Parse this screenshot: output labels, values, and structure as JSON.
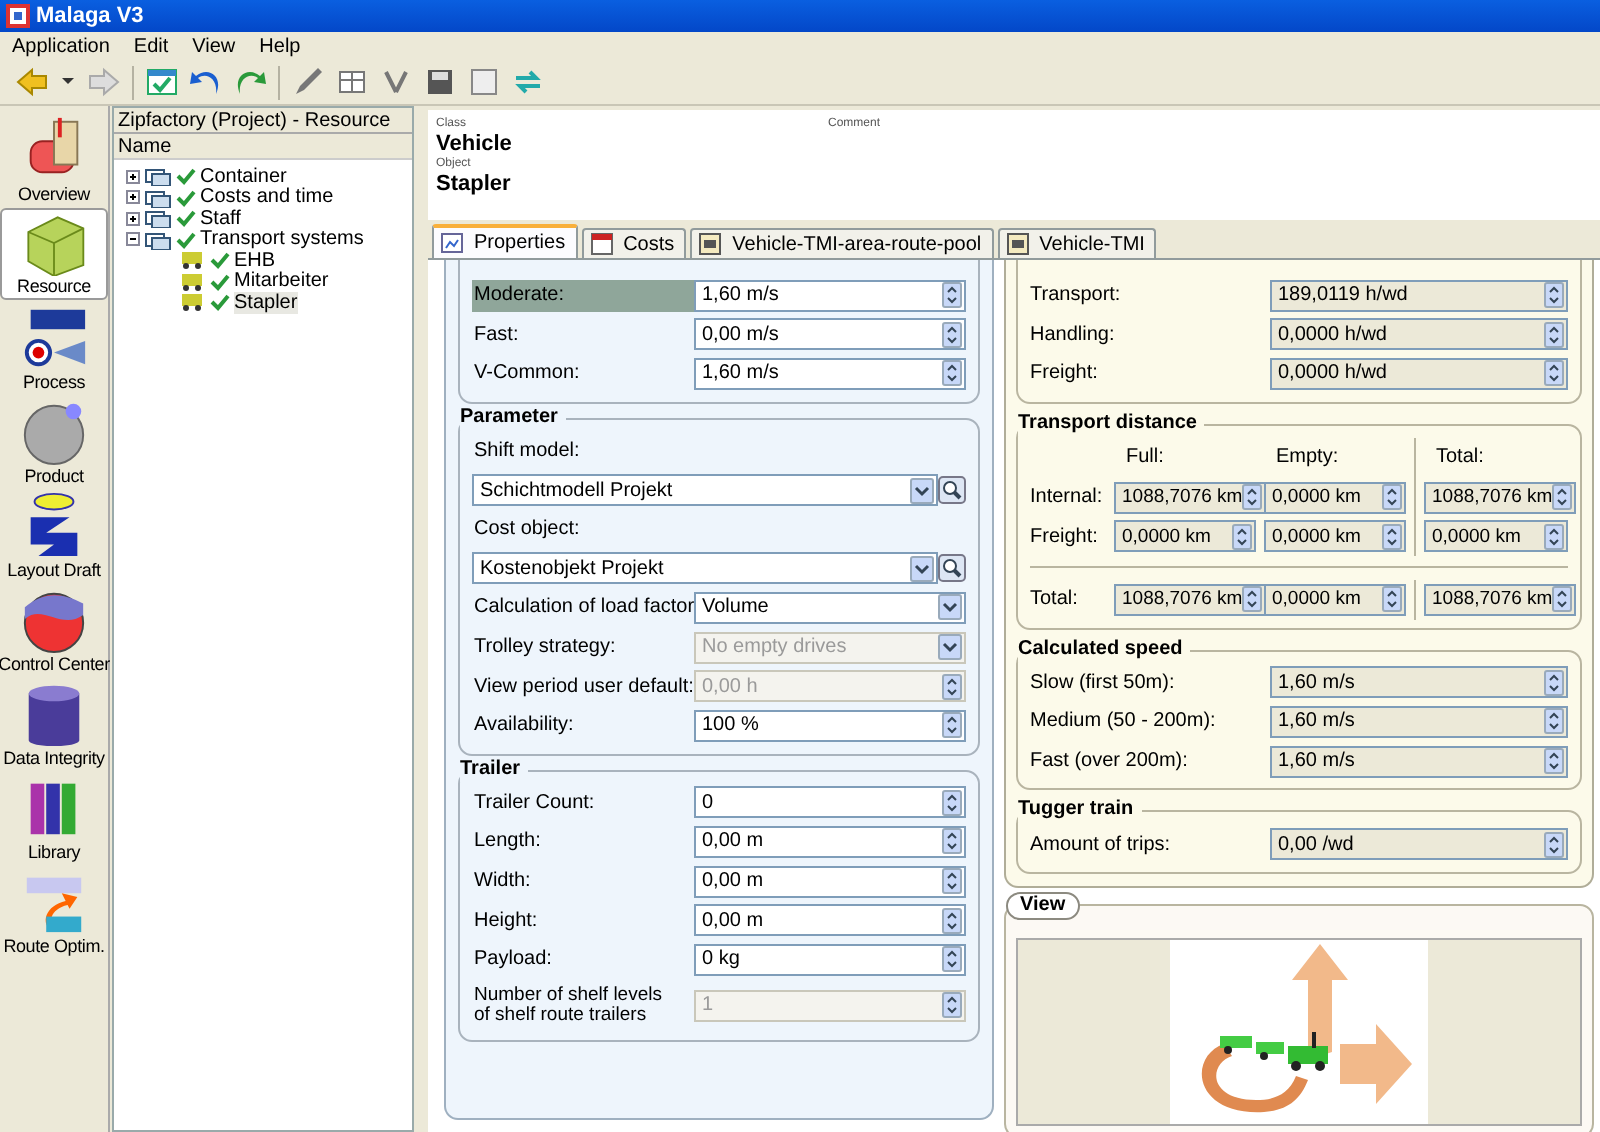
{
  "window": {
    "title": "Malaga V3"
  },
  "menu": [
    "Application",
    "Edit",
    "View",
    "Help"
  ],
  "nav": [
    {
      "label": "Overview",
      "selected": false
    },
    {
      "label": "Resource",
      "selected": true
    },
    {
      "label": "Process",
      "selected": false
    },
    {
      "label": "Product",
      "selected": false
    },
    {
      "label": "Layout Draft",
      "selected": false
    },
    {
      "label": "Control Center",
      "selected": false
    },
    {
      "label": "Data Integrity",
      "selected": false
    },
    {
      "label": "Library",
      "selected": false
    },
    {
      "label": "Route Optim.",
      "selected": false
    }
  ],
  "tree": {
    "title": "Zipfactory (Project) - Resource",
    "column": "Name",
    "items": [
      {
        "label": "Container",
        "expanded": false,
        "selected": false
      },
      {
        "label": "Costs and time",
        "expanded": false,
        "selected": false
      },
      {
        "label": "Staff",
        "expanded": false,
        "selected": false
      },
      {
        "label": "Transport systems",
        "expanded": true,
        "selected": false,
        "children": [
          {
            "label": "EHB",
            "selected": false
          },
          {
            "label": "Mitarbeiter",
            "selected": false
          },
          {
            "label": "Stapler",
            "selected": true
          }
        ]
      }
    ]
  },
  "header": {
    "class_label": "Class",
    "class_value": "Vehicle",
    "object_label": "Object",
    "object_value": "Stapler",
    "comment_label": "Comment"
  },
  "tabs": [
    {
      "label": "Properties",
      "selected": true
    },
    {
      "label": "Costs",
      "selected": false
    },
    {
      "label": "Vehicle-TMI-area-route-pool",
      "selected": false
    },
    {
      "label": "Vehicle-TMI",
      "selected": false
    }
  ],
  "left_groups": [
    {
      "rows": [
        {
          "kind": "spin",
          "label": "Moderate:",
          "value": "1,60 m/s",
          "highlighted": true,
          "disabled": false
        },
        {
          "kind": "spin",
          "label": "Fast:",
          "value": "0,00 m/s",
          "highlighted": false,
          "disabled": false
        },
        {
          "kind": "spin",
          "label": "V-Common:",
          "value": "1,60 m/s",
          "highlighted": false,
          "disabled": false
        }
      ]
    },
    {
      "title": "Parameter",
      "rows": [
        {
          "kind": "lookup",
          "label": "Shift model:",
          "value": "Schichtmodell Projekt",
          "highlighted": false,
          "disabled": false
        },
        {
          "kind": "lookup",
          "label": "Cost object:",
          "value": "Kostenobjekt Projekt",
          "highlighted": false,
          "disabled": false
        },
        {
          "kind": "combo",
          "label": "Calculation of load factor:",
          "value": "Volume",
          "highlighted": false,
          "disabled": false
        },
        {
          "kind": "combo",
          "label": "Trolley strategy:",
          "value": "No empty drives",
          "highlighted": false,
          "disabled": true
        },
        {
          "kind": "spin",
          "label": "View period user default:",
          "value": "0,00 h",
          "highlighted": false,
          "disabled": true
        },
        {
          "kind": "spin",
          "label": "Availability:",
          "value": "100 %",
          "highlighted": false,
          "disabled": false
        }
      ]
    },
    {
      "title": "Trailer",
      "rows": [
        {
          "kind": "spin",
          "label": "Trailer Count:",
          "value": "0",
          "highlighted": false,
          "disabled": false
        },
        {
          "kind": "spin",
          "label": "Length:",
          "value": "0,00 m",
          "highlighted": false,
          "disabled": false
        },
        {
          "kind": "spin",
          "label": "Width:",
          "value": "0,00 m",
          "highlighted": false,
          "disabled": false
        },
        {
          "kind": "spin",
          "label": "Height:",
          "value": "0,00 m",
          "highlighted": false,
          "disabled": false
        },
        {
          "kind": "spin",
          "label": "Payload:",
          "value": "0 kg",
          "highlighted": false,
          "disabled": false
        },
        {
          "kind": "spin",
          "label": "Number of shelf levels\nof shelf route trailers",
          "value": "1",
          "highlighted": false,
          "disabled": true
        }
      ]
    }
  ],
  "right_groups": [
    {
      "kind": "rows",
      "rows": [
        {
          "label": "Transport:",
          "value": "189,0119 h/wd"
        },
        {
          "label": "Handling:",
          "value": "0,0000 h/wd"
        },
        {
          "label": "Freight:",
          "value": "0,0000 h/wd"
        }
      ]
    },
    {
      "kind": "distance",
      "title": "Transport distance",
      "columns": [
        "Full:",
        "Empty:",
        "Total:"
      ],
      "rows": [
        {
          "label": "Internal:",
          "values": [
            "1088,7076 km",
            "0,0000 km",
            "1088,7076 km"
          ]
        },
        {
          "label": "Freight:",
          "values": [
            "0,0000 km",
            "0,0000 km",
            "0,0000 km"
          ]
        },
        {
          "label": "Total:",
          "values": [
            "1088,7076 km",
            "0,0000 km",
            "1088,7076 km"
          ]
        }
      ]
    },
    {
      "kind": "rows",
      "title": "Calculated speed",
      "rows": [
        {
          "label": "Slow (first 50m):",
          "value": "1,60 m/s"
        },
        {
          "label": "Medium (50 - 200m):",
          "value": "1,60 m/s"
        },
        {
          "label": "Fast (over 200m):",
          "value": "1,60 m/s"
        }
      ]
    },
    {
      "kind": "rows",
      "title": "Tugger train",
      "rows": [
        {
          "label": "Amount of trips:",
          "value": "0,00 /wd"
        }
      ]
    }
  ],
  "view": {
    "title": "View"
  }
}
